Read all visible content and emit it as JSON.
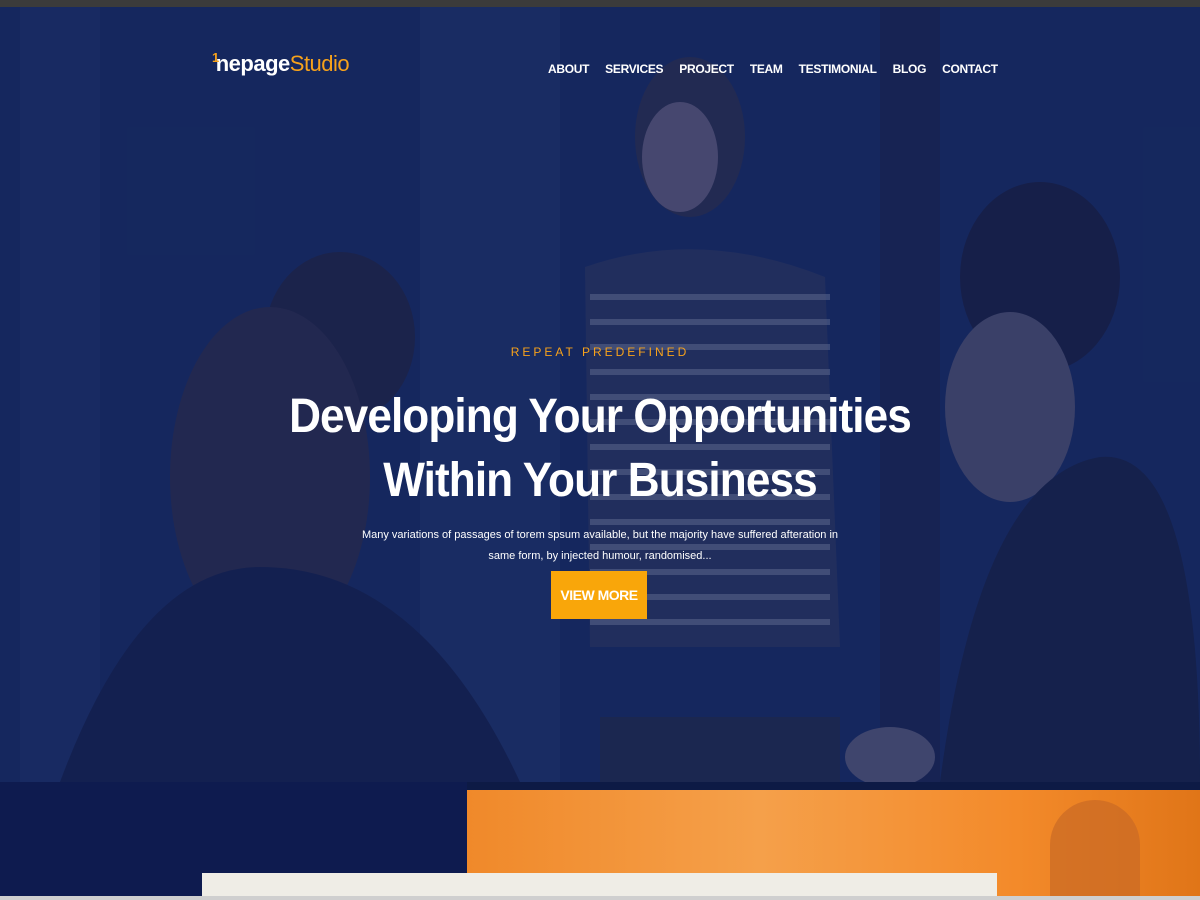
{
  "brand": {
    "prefix": "1",
    "name_main": "nepage",
    "name_accent": "Studio"
  },
  "nav": [
    {
      "label": "ABOUT"
    },
    {
      "label": "SERVICES"
    },
    {
      "label": "PROJECT"
    },
    {
      "label": "TEAM"
    },
    {
      "label": "TESTIMONIAL"
    },
    {
      "label": "BLOG"
    },
    {
      "label": "CONTACT"
    }
  ],
  "hero": {
    "eyebrow": "REPEAT PREDEFINED",
    "headline_line1": "Developing Your Opportunities",
    "headline_line2": "Within Your Business",
    "description": "Many variations of passages of torem spsum available, but the majority have suffered afteration in same form, by injected humour, randomised...",
    "cta_label": "VIEW MORE"
  },
  "colors": {
    "accent": "#f9a60a",
    "overlay": "#0e1e50",
    "section_orange": "#f38a2a"
  }
}
